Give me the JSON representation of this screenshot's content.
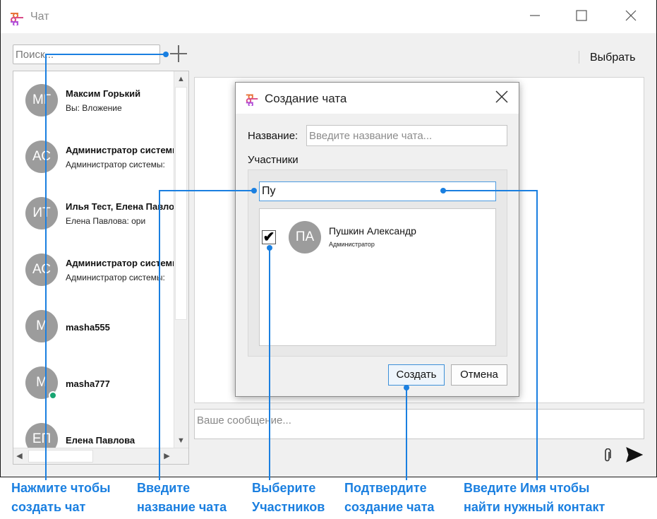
{
  "window": {
    "title": "Чат"
  },
  "toolbar": {
    "search_placeholder": "Поиск...",
    "select_label": "Выбрать"
  },
  "chats": [
    {
      "initials": "МГ",
      "name": "Максим Горький",
      "last_message": "Вы: Вложение",
      "online": false
    },
    {
      "initials": "АС",
      "name": "Администратор системы",
      "last_message": "Администратор системы: ",
      "online": false
    },
    {
      "initials": "ИТ",
      "name": "Илья Тест, Елена Павлова",
      "last_message": "Елена Павлова: ори",
      "online": false
    },
    {
      "initials": "АС",
      "name": "Администратор системы",
      "last_message": "Администратор системы: ",
      "online": false
    },
    {
      "initials": "М",
      "name": "masha555",
      "last_message": "",
      "online": false
    },
    {
      "initials": "М",
      "name": "masha777",
      "last_message": "",
      "online": true
    },
    {
      "initials": "ЕП",
      "name": "Елена Павлова",
      "last_message": "",
      "online": false
    }
  ],
  "compose": {
    "placeholder": "Ваше сообщение..."
  },
  "dialog": {
    "title": "Создание чата",
    "name_label": "Название:",
    "name_placeholder": "Введите название чата...",
    "participants_label": "Участники",
    "filter_value": "Пу",
    "participants": [
      {
        "initials": "ПА",
        "name": "Пушкин Александр",
        "role": "Администратор",
        "checked": true
      }
    ],
    "create_label": "Создать",
    "cancel_label": "Отмена"
  },
  "callouts": [
    {
      "line1": "Нажмите чтобы",
      "line2": "создать чат"
    },
    {
      "line1": "Введите",
      "line2": "название чата"
    },
    {
      "line1": "Выберите",
      "line2": "Участников"
    },
    {
      "line1": "Подтвердите",
      "line2": "создание чата"
    },
    {
      "line1": "Введите Имя чтобы",
      "line2": "найти нужный контакт"
    }
  ],
  "colors": {
    "accent": "#1a7fe0",
    "online": "#18a572",
    "avatar": "#9c9c9c"
  }
}
